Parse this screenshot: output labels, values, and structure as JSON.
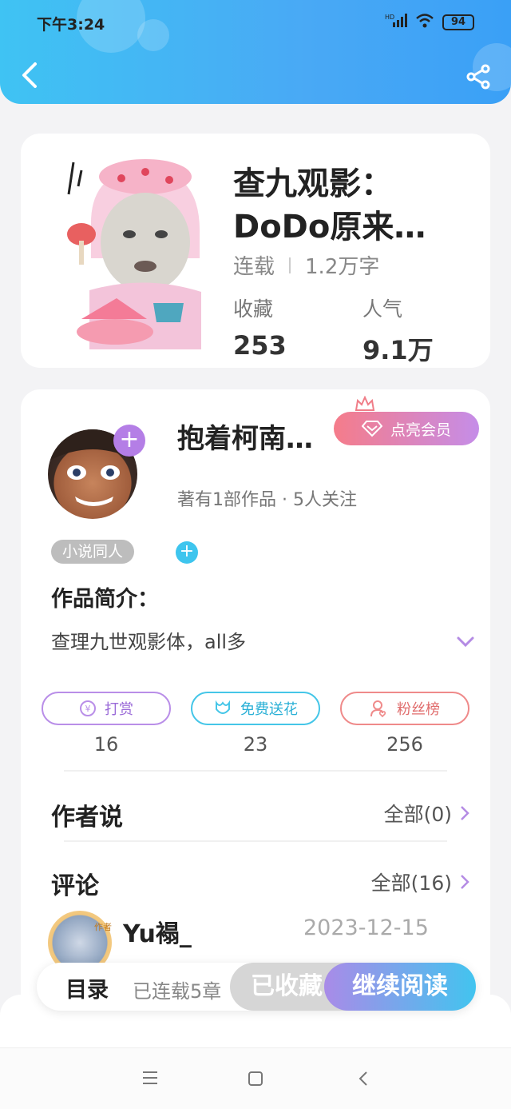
{
  "status_bar": {
    "time": "下午3:24",
    "network": "HD",
    "battery": "94"
  },
  "book": {
    "title": "查九观影：DoDo原来…",
    "status": "连载",
    "word_count": "1.2万字",
    "favorites_label": "收藏",
    "favorites_value": "253",
    "popularity_label": "人气",
    "popularity_value": "9.1万"
  },
  "author": {
    "name": "抱着柯南…",
    "vip_label": "点亮会员",
    "meta": "著有1部作品 · 5人关注",
    "tag": "小说同人"
  },
  "intro": {
    "title": "作品简介：",
    "text": "查理九世观影体，all多"
  },
  "actions": [
    {
      "label": "打赏",
      "count": "16",
      "color": "#b98ee8"
    },
    {
      "label": "免费送花",
      "count": "23",
      "color": "#45c6e8"
    },
    {
      "label": "粉丝榜",
      "count": "256",
      "color": "#ef8a8a"
    }
  ],
  "author_says": {
    "title": "作者说",
    "link": "全部(0)"
  },
  "comments": {
    "title": "评论",
    "link": "全部(16)",
    "first": {
      "user": "Yu褟_",
      "date": "2023-12-15",
      "badge": "作者"
    }
  },
  "bottom_bar": {
    "toc": "目录",
    "toc_status": "已连载5章",
    "collected": "已收藏",
    "continue": "继续阅读"
  }
}
